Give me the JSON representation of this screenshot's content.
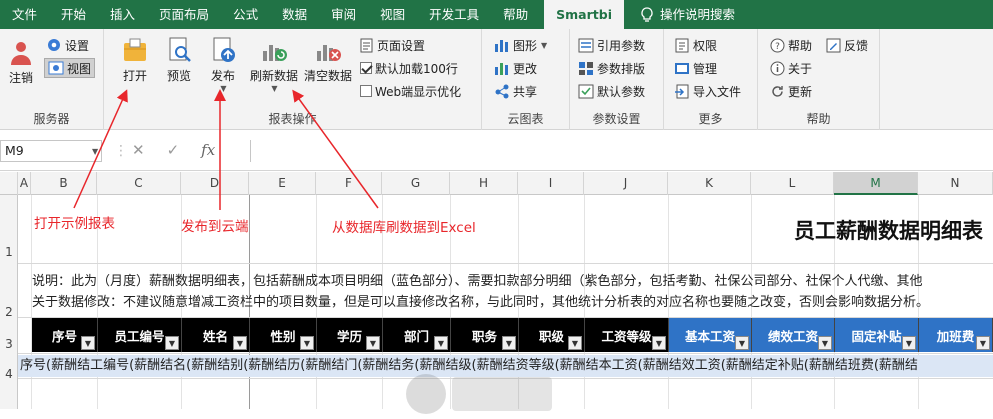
{
  "menu": {
    "tabs": [
      "文件",
      "开始",
      "插入",
      "页面布局",
      "公式",
      "数据",
      "审阅",
      "视图",
      "开发工具",
      "帮助"
    ],
    "active_tab": "Smartbi",
    "tell_me": "操作说明搜索"
  },
  "ribbon": {
    "server": {
      "logout": "注销",
      "settings": "设置",
      "view": "视图",
      "label": "服务器"
    },
    "report": {
      "open": "打开",
      "preview": "预览",
      "publish": "发布",
      "refresh": "刷新数据",
      "clear": "清空数据",
      "page_setup": "页面设置",
      "default_load": "默认加载100行",
      "web_optimize": "Web端显示优化",
      "default_load_checked": true,
      "web_optimize_checked": false,
      "label": "报表操作"
    },
    "cloud": {
      "chart": "图形",
      "change": "更改",
      "share": "共享",
      "label": "云图表"
    },
    "params": {
      "ref": "引用参数",
      "layout": "参数排版",
      "default": "默认参数",
      "label": "参数设置"
    },
    "more": {
      "perm": "权限",
      "manage": "管理",
      "import": "导入文件",
      "label": "更多"
    },
    "help": {
      "help": "帮助",
      "feedback": "反馈",
      "about": "关于",
      "update": "更新",
      "label": "帮助"
    }
  },
  "formula_bar": {
    "name_box": "M9",
    "fx": "fx"
  },
  "columns": [
    "A",
    "B",
    "C",
    "D",
    "E",
    "F",
    "G",
    "H",
    "I",
    "J",
    "K",
    "L",
    "M",
    "N"
  ],
  "selected_column": "M",
  "rows": [
    "1",
    "2",
    "3",
    "4"
  ],
  "sheet": {
    "title": "员工薪酬数据明细表",
    "desc1": "说明：此为（月度）薪酬数据明细表，包括薪酬成本项目明细（蓝色部分）、需要扣款部分明细（紫色部分，包括考勤、社保公司部分、社保个人代缴、其他",
    "desc2": "关于数据修改：不建议随意增减工资栏中的项目数量，但是可以直接修改名称，与此同时，其他统计分析表的对应名称也要随之改变，否则会影响数据分析。",
    "headers": [
      "序号",
      "员工编号",
      "姓名",
      "性别",
      "学历",
      "部门",
      "职务",
      "职级",
      "工资等级",
      "基本工资",
      "绩效工资",
      "固定补贴",
      "加班费"
    ],
    "data_row": "序号(薪酬结工编号(薪酬结名(薪酬结别(薪酬结历(薪酬结门(薪酬结务(薪酬结级(薪酬结资等级(薪酬结本工资(薪酬结效工资(薪酬结定补贴(薪酬结班费(薪酬结"
  },
  "annotations": {
    "open": "打开示例报表",
    "publish": "发布到云端",
    "refresh": "从数据库刷数据到Excel"
  },
  "colors": {
    "excel_green": "#217346",
    "header_dark": "#000000",
    "header_blue": "#2f73c6",
    "annotation": "#e8262b"
  }
}
